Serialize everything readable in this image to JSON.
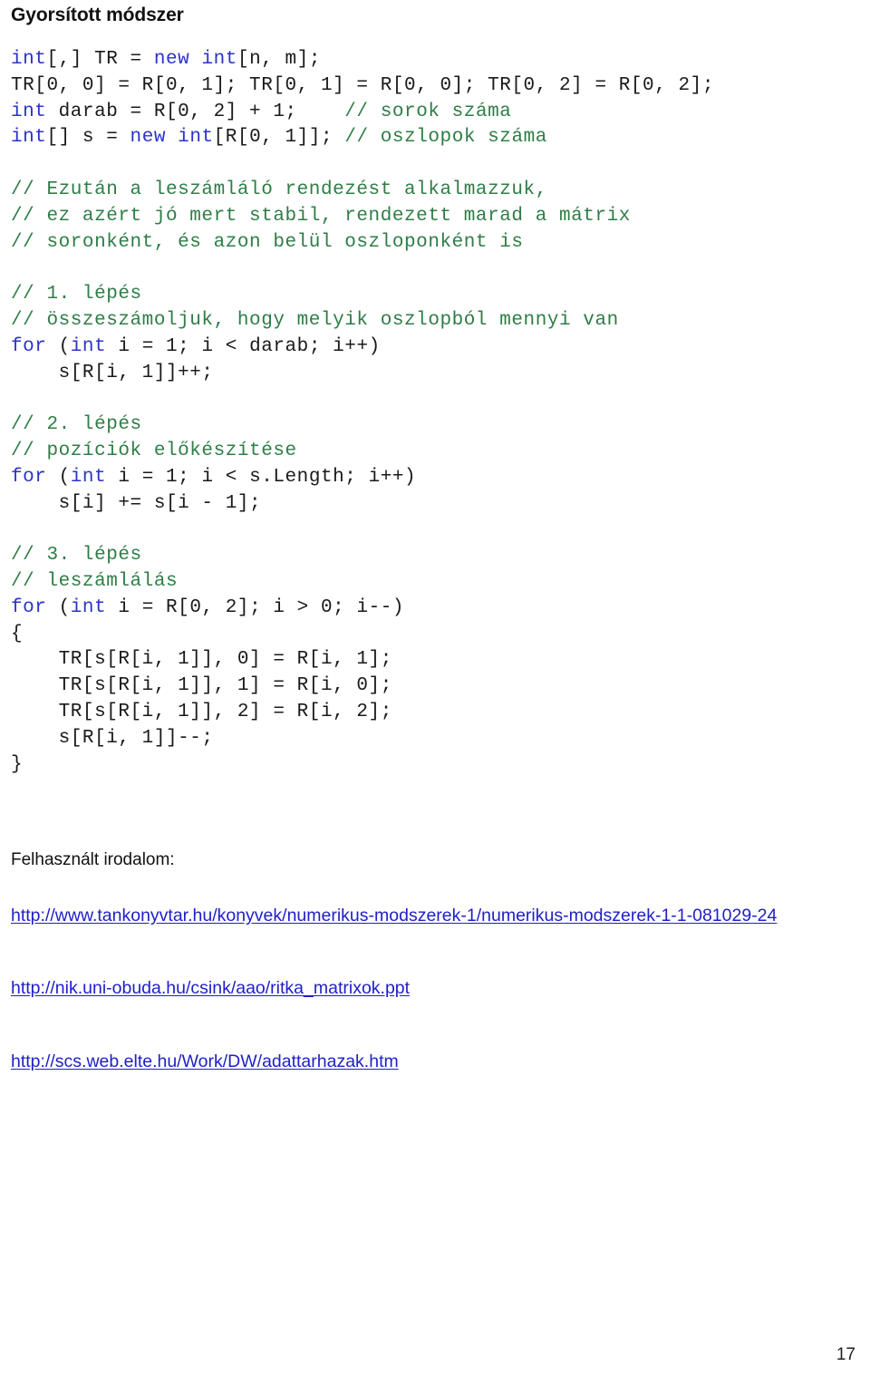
{
  "document": {
    "title": "Gyorsított módszer",
    "page_number": "17"
  },
  "code": {
    "language": "csharp",
    "lines": [
      [
        {
          "t": "int",
          "c": "kw"
        },
        {
          "t": "[,] TR = ",
          "c": "pl"
        },
        {
          "t": "new",
          "c": "kw"
        },
        {
          "t": " ",
          "c": "pl"
        },
        {
          "t": "int",
          "c": "kw"
        },
        {
          "t": "[n, m];",
          "c": "pl"
        }
      ],
      [
        {
          "t": "TR[0, 0] = R[0, 1]; TR[0, 1] = R[0, 0]; TR[0, 2] = R[0, 2];",
          "c": "pl"
        }
      ],
      [
        {
          "t": "int",
          "c": "kw"
        },
        {
          "t": " darab = R[0, 2] + 1;    ",
          "c": "pl"
        },
        {
          "t": "// sorok száma",
          "c": "cm"
        }
      ],
      [
        {
          "t": "int",
          "c": "kw"
        },
        {
          "t": "[] s = ",
          "c": "pl"
        },
        {
          "t": "new",
          "c": "kw"
        },
        {
          "t": " ",
          "c": "pl"
        },
        {
          "t": "int",
          "c": "kw"
        },
        {
          "t": "[R[0, 1]]; ",
          "c": "pl"
        },
        {
          "t": "// oszlopok száma",
          "c": "cm"
        }
      ],
      [],
      [
        {
          "t": "// Ezután a leszámláló rendezést alkalmazzuk,",
          "c": "cm"
        }
      ],
      [
        {
          "t": "// ez azért jó mert stabil, rendezett marad a mátrix",
          "c": "cm"
        }
      ],
      [
        {
          "t": "// soronként, és azon belül oszloponként is",
          "c": "cm"
        }
      ],
      [],
      [
        {
          "t": "// 1. lépés",
          "c": "cm"
        }
      ],
      [
        {
          "t": "// összeszámoljuk, hogy melyik oszlopból mennyi van",
          "c": "cm"
        }
      ],
      [
        {
          "t": "for",
          "c": "kw"
        },
        {
          "t": " (",
          "c": "pl"
        },
        {
          "t": "int",
          "c": "kw"
        },
        {
          "t": " i = 1; i < darab; i++)",
          "c": "pl"
        }
      ],
      [
        {
          "t": "    s[R[i, 1]]++;",
          "c": "pl"
        }
      ],
      [],
      [
        {
          "t": "// 2. lépés",
          "c": "cm"
        }
      ],
      [
        {
          "t": "// pozíciók előkészítése",
          "c": "cm"
        }
      ],
      [
        {
          "t": "for",
          "c": "kw"
        },
        {
          "t": " (",
          "c": "pl"
        },
        {
          "t": "int",
          "c": "kw"
        },
        {
          "t": " i = 1; i < s.Length; i++)",
          "c": "pl"
        }
      ],
      [
        {
          "t": "    s[i] += s[i - 1];",
          "c": "pl"
        }
      ],
      [],
      [
        {
          "t": "// 3. lépés",
          "c": "cm"
        }
      ],
      [
        {
          "t": "// leszámlálás",
          "c": "cm"
        }
      ],
      [
        {
          "t": "for",
          "c": "kw"
        },
        {
          "t": " (",
          "c": "pl"
        },
        {
          "t": "int",
          "c": "kw"
        },
        {
          "t": " i = R[0, 2]; i > 0; i--)",
          "c": "pl"
        }
      ],
      [
        {
          "t": "{",
          "c": "pl"
        }
      ],
      [
        {
          "t": "    TR[s[R[i, 1]], 0] = R[i, 1];",
          "c": "pl"
        }
      ],
      [
        {
          "t": "    TR[s[R[i, 1]], 1] = R[i, 0];",
          "c": "pl"
        }
      ],
      [
        {
          "t": "    TR[s[R[i, 1]], 2] = R[i, 2];",
          "c": "pl"
        }
      ],
      [
        {
          "t": "    s[R[i, 1]]--;",
          "c": "pl"
        }
      ],
      [
        {
          "t": "}",
          "c": "pl"
        }
      ]
    ]
  },
  "references": {
    "heading": "Felhasznált irodalom:",
    "links": [
      "http://www.tankonyvtar.hu/konyvek/numerikus-modszerek-1/numerikus-modszerek-1-1-081029-24",
      "http://nik.uni-obuda.hu/csink/aao/ritka_matrixok.ppt",
      "http://scs.web.elte.hu/Work/DW/adattarhazak.htm"
    ]
  },
  "colors": {
    "keyword": "#2a34c8",
    "comment": "#2e7d46",
    "plain": "#1a1a1a",
    "link": "#1f1fc8",
    "text": "#111111",
    "background": "#ffffff"
  }
}
